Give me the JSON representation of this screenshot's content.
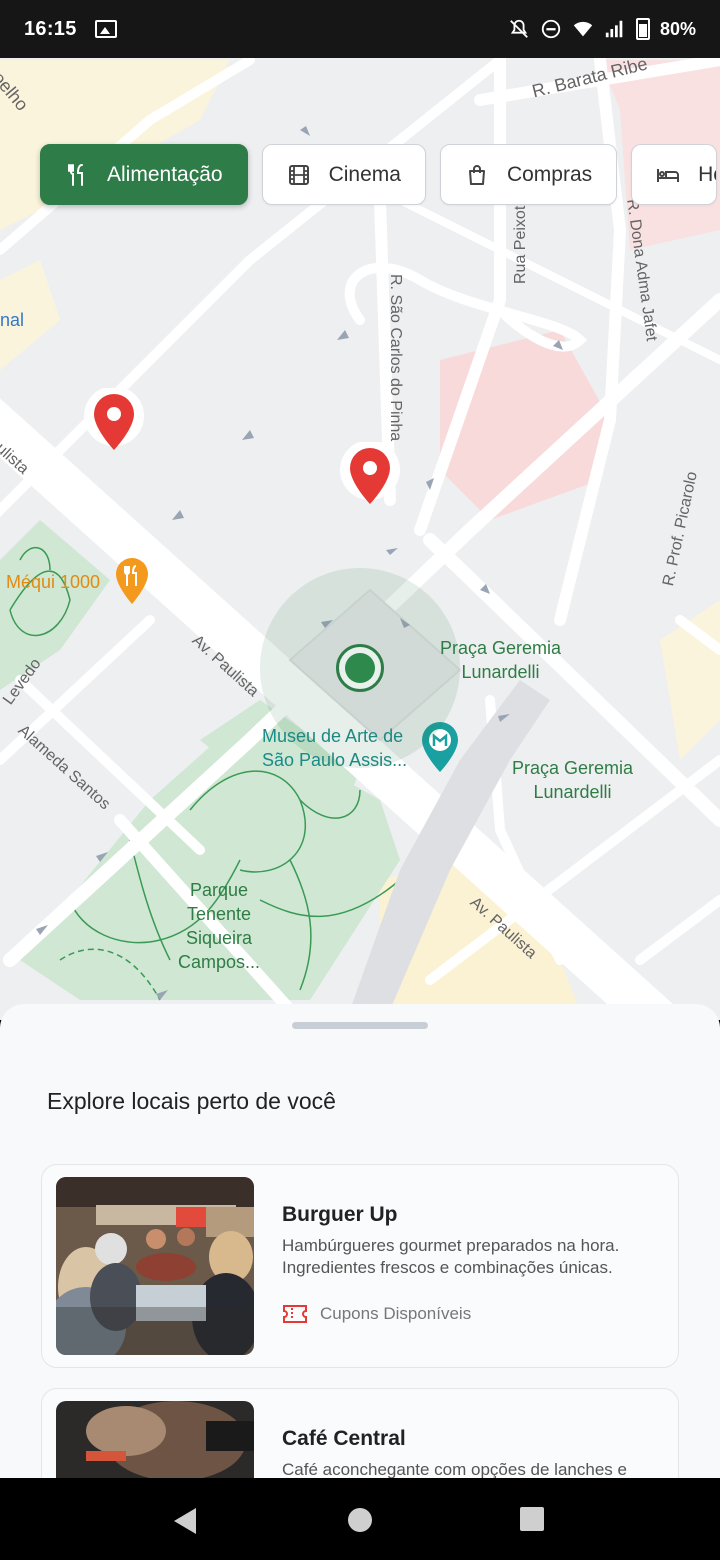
{
  "status_bar": {
    "time": "16:15",
    "battery": "80%"
  },
  "categories": [
    {
      "label": "Alimentação",
      "icon": "utensils-icon",
      "active": true
    },
    {
      "label": "Cinema",
      "icon": "film-icon",
      "active": false
    },
    {
      "label": "Compras",
      "icon": "shopping-bag-icon",
      "active": false
    },
    {
      "label": "Ho",
      "icon": "bed-icon",
      "active": false
    }
  ],
  "map": {
    "labels": {
      "street_barata": "R. Barata Ribe",
      "street_coelho": "oelho",
      "street_nal": "nal",
      "street_sao_carlos": "R. São Carlos do Pinha",
      "street_rua_peixoto": "Rua Peixoto",
      "street_dona_adma": "R. Dona Adma Jafet",
      "street_prof_picarolo": "R. Prof. Picarolo",
      "street_paulista_left": "ulista",
      "street_paulista_mid": "Av. Paulista",
      "street_paulista_lower": "Av. Paulista",
      "street_levedo": "Levedo",
      "street_alameda_santos": "Alameda Santos",
      "poi_mequi": "Méqui 1000",
      "poi_praca_1": "Praça Geremia\nLunardelli",
      "poi_praca_2": "Praça Geremia\nLunardelli",
      "poi_museu": "Museu de Arte de\nSão Paulo Assis...",
      "poi_parque": "Parque\nTenente\nSiqueira\nCampos..."
    },
    "colors": {
      "park": "#cfe7d3",
      "road": "#ffffff",
      "block": "#eeeff1",
      "pink": "#f9dcdc",
      "yellow": "#fbf3d6"
    }
  },
  "sheet": {
    "title": "Explore locais perto de você",
    "places": [
      {
        "name": "Burguer Up",
        "description": "Hambúrgueres gourmet preparados na hora. Ingredientes frescos e combinações únicas.",
        "coupon": "Cupons Disponíveis"
      },
      {
        "name": "Café Central",
        "description": "Café aconchegante com opções de lanches e",
        "coupon": ""
      }
    ]
  },
  "colors": {
    "accent": "#2e7d49",
    "pin": "#e53935"
  }
}
